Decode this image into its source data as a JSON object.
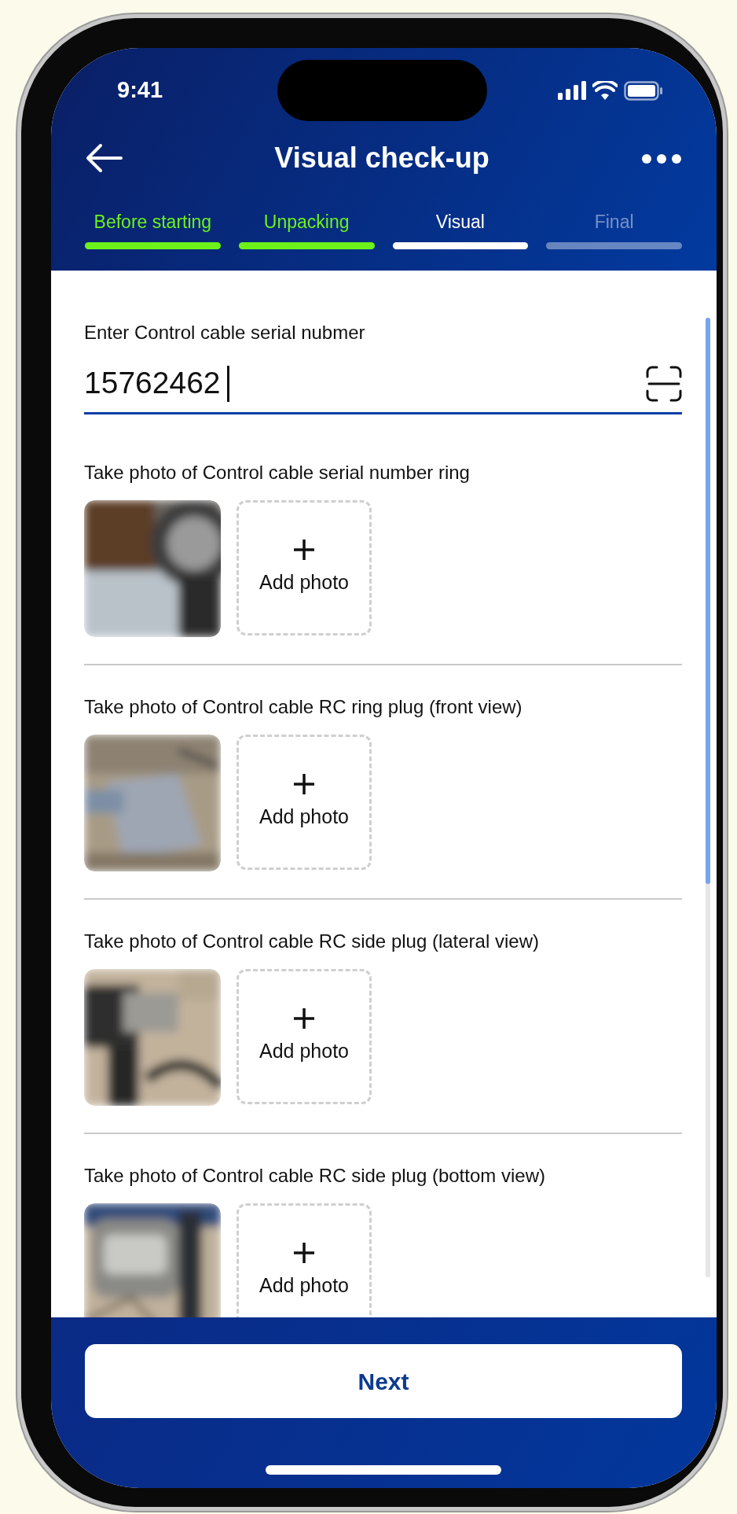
{
  "status_bar": {
    "time": "9:41"
  },
  "header": {
    "title": "Visual check-up"
  },
  "steps": [
    {
      "label": "Before starting",
      "kind": "done"
    },
    {
      "label": "Unpacking",
      "kind": "done"
    },
    {
      "label": "Visual",
      "kind": "current"
    },
    {
      "label": "Final",
      "kind": "pending"
    }
  ],
  "serial_field": {
    "label": "Enter Control cable serial nubmer",
    "value": "15762462"
  },
  "photo_sections": [
    {
      "title": "Take photo of Control cable serial number ring",
      "add_label": "Add photo"
    },
    {
      "title": "Take photo of Control cable RC ring plug (front view)",
      "add_label": "Add photo"
    },
    {
      "title": "Take photo of Control cable RC side plug (lateral view)",
      "add_label": "Add photo"
    },
    {
      "title": "Take photo of Control cable RC side plug (bottom view)",
      "add_label": "Add photo"
    }
  ],
  "footer": {
    "button": "Next"
  }
}
